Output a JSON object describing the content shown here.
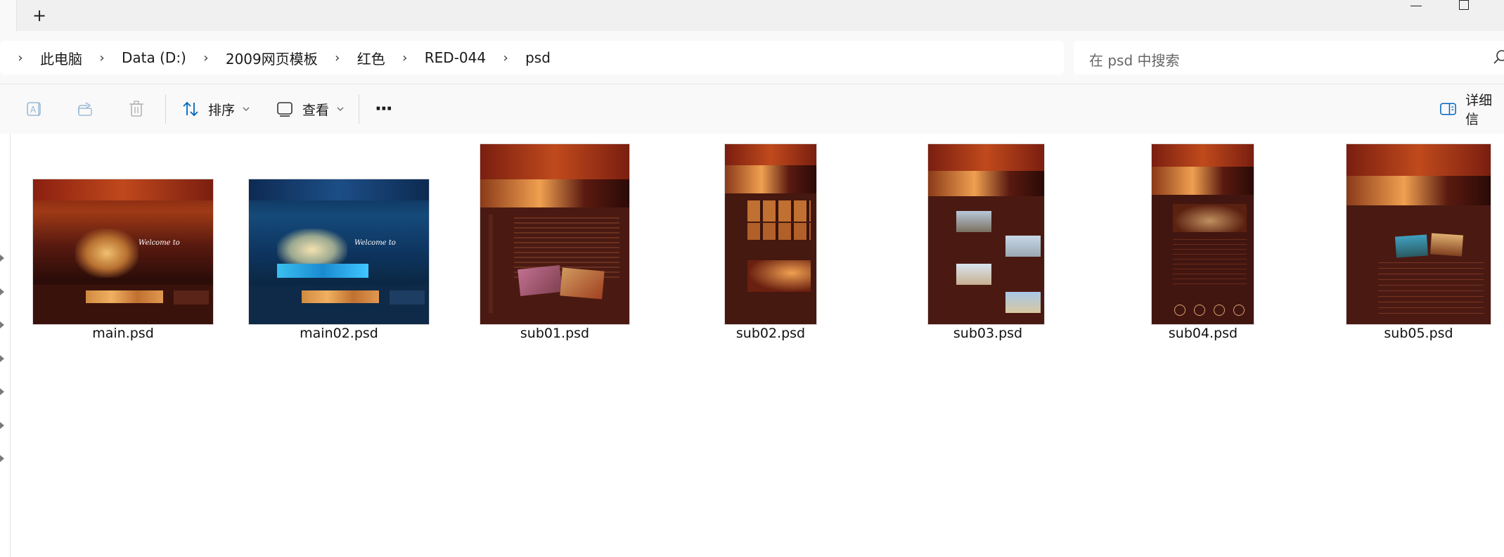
{
  "tabbar": {
    "new_tab_icon": "plus-icon"
  },
  "breadcrumb": {
    "items": [
      {
        "label": "此电脑"
      },
      {
        "label": "Data (D:)"
      },
      {
        "label": "2009网页模板"
      },
      {
        "label": "红色"
      },
      {
        "label": "RED-044"
      },
      {
        "label": "psd"
      }
    ]
  },
  "search": {
    "placeholder": "在 psd 中搜索"
  },
  "toolbar": {
    "sort_label": "排序",
    "view_label": "查看",
    "more_label": "···",
    "details_label": "详细信"
  },
  "files": [
    {
      "name": "main.psd",
      "theme": "red-wide"
    },
    {
      "name": "main02.psd",
      "theme": "blue-wide"
    },
    {
      "name": "sub01.psd",
      "theme": "red-tall"
    },
    {
      "name": "sub02.psd",
      "theme": "red-narrow"
    },
    {
      "name": "sub03.psd",
      "theme": "red-tall"
    },
    {
      "name": "sub04.psd",
      "theme": "red-narrow"
    },
    {
      "name": "sub05.psd",
      "theme": "red-tall"
    }
  ],
  "colors": {
    "accent": "#0067c0",
    "thumb_red_dark": "#3b120c",
    "thumb_red_mid": "#8a2a14",
    "thumb_blue_dark": "#0b2a4a"
  }
}
